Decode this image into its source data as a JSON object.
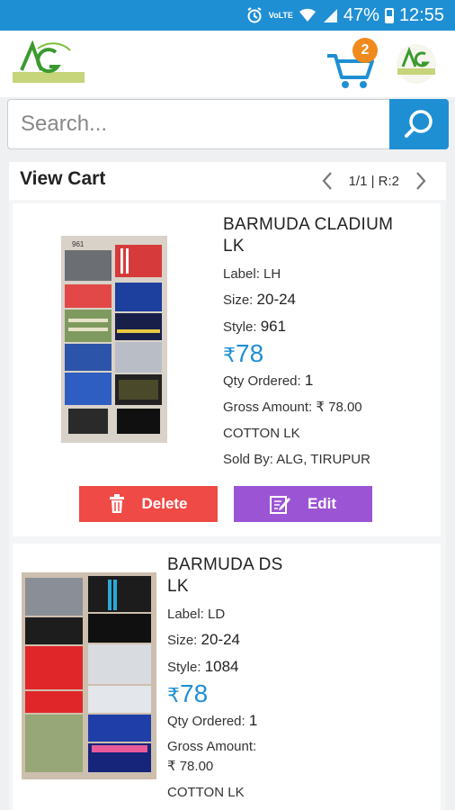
{
  "status": {
    "signal": "VoLTE",
    "battery": "47%",
    "time": "12:55"
  },
  "header": {
    "cart_count": "2"
  },
  "search": {
    "placeholder": "Search..."
  },
  "cart": {
    "title": "View Cart",
    "pager": "1/1 | R:2"
  },
  "items": [
    {
      "name_line1": "BARMUDA CLADIUM",
      "name_line2": "LK",
      "label_key": "Label:",
      "label": "LH",
      "size_key": "Size:",
      "size": "20-24",
      "style_key": "Style:",
      "style": "961",
      "price_symbol": "₹",
      "price": "78",
      "qty_key": "Qty Ordered:",
      "qty": "1",
      "gross_key": "Gross Amount:",
      "gross": "₹ 78.00",
      "material": "COTTON LK",
      "sold_key": "Sold By:",
      "sold_by": "ALG, TIRUPUR",
      "image_tag": "961"
    },
    {
      "name_line1": "BARMUDA DS",
      "name_line2": "LK",
      "label_key": "Label:",
      "label": "LD",
      "size_key": "Size:",
      "size": "20-24",
      "style_key": "Style:",
      "style": "1084",
      "price_symbol": "₹",
      "price": "78",
      "qty_key": "Qty Ordered:",
      "qty": "1",
      "gross_key": "Gross Amount:",
      "gross": "₹ 78.00",
      "material": "COTTON LK"
    }
  ],
  "actions": {
    "delete_label": "Delete",
    "edit_label": "Edit"
  },
  "colors": {
    "primary": "#1f8fd4",
    "badge": "#f08a1c",
    "delete": "#ef4a45",
    "edit": "#9b55d4"
  }
}
